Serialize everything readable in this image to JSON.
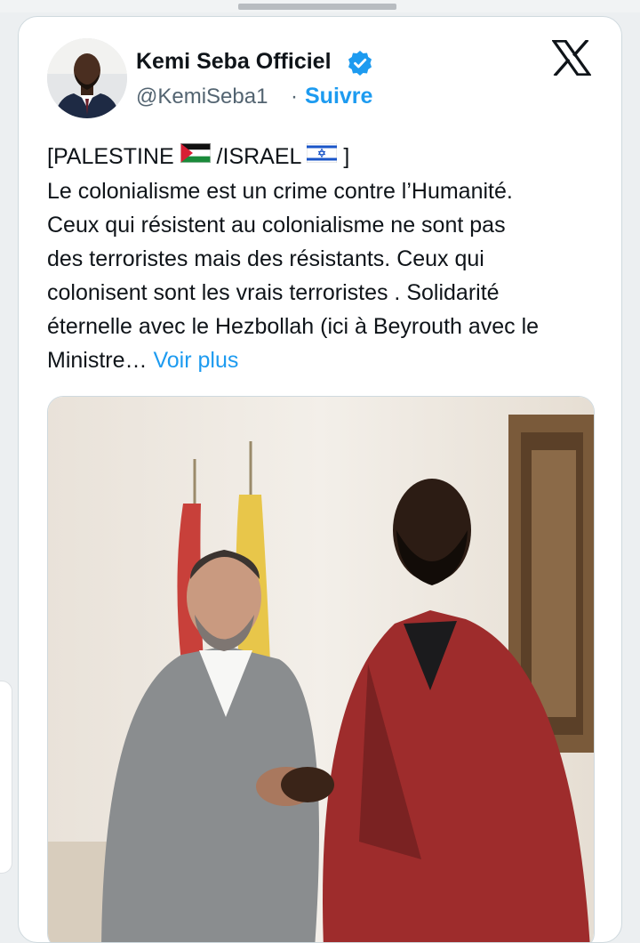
{
  "author": {
    "name": "Kemi Seba Officiel",
    "handle": "@KemiSeba1",
    "separator": "·",
    "follow_label": "Suivre",
    "verified": true
  },
  "platform_icon": "x-logo-icon",
  "tweet": {
    "line1_prefix": "[PALESTINE",
    "line1_middle": " /ISRAEL",
    "line1_suffix": "]",
    "line2": "Le colonialisme est un crime contre l’Humanité.",
    "line3": "Ceux qui résistent au colonialisme ne sont pas",
    "line4": "des terroristes mais des résistants. Ceux qui",
    "line5": "colonisent sont les vrais terroristes . Solidarité",
    "line6": "éternelle avec le Hezbollah (ici à Beyrouth avec le",
    "line7": "Ministre…",
    "more_label": "Voir plus",
    "flags": [
      "palestine-flag-icon",
      "israel-flag-icon"
    ]
  },
  "colors": {
    "accent": "#1d9bf0",
    "text": "#0f1419",
    "muted": "#536471",
    "border": "#cfd9de"
  }
}
